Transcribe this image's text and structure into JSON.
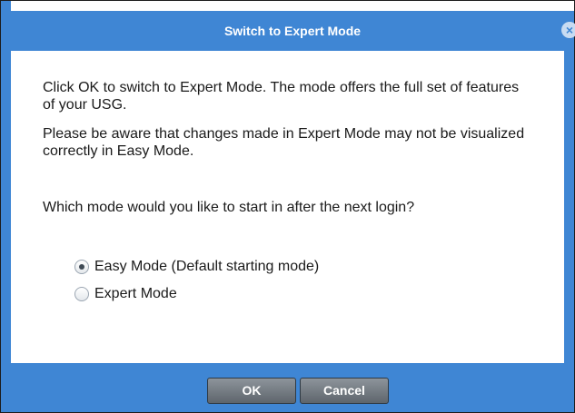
{
  "dialog": {
    "title": "Switch to Expert Mode",
    "close_icon": "close-icon",
    "message_1": "Click OK to switch to Expert Mode. The mode offers the full set of features of your USG.",
    "message_2": "Please be aware that changes made in Expert Mode may not be visualized correctly in Easy Mode.",
    "question": "Which mode would you like to start in after the next login?",
    "options": [
      {
        "label": "Easy Mode (Default starting mode)",
        "selected": true
      },
      {
        "label": "Expert Mode",
        "selected": false
      }
    ],
    "buttons": {
      "ok": "OK",
      "cancel": "Cancel"
    },
    "colors": {
      "accent": "#3f86d4",
      "button": "#6f767d"
    }
  }
}
